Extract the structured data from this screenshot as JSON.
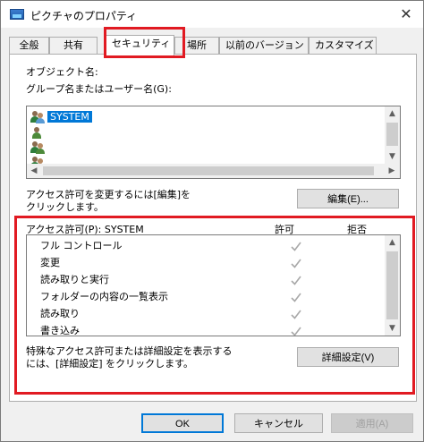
{
  "window": {
    "title": "ピクチャのプロパティ",
    "close_glyph": "✕"
  },
  "tabs": [
    {
      "label": "全般",
      "active": false
    },
    {
      "label": "共有",
      "active": false
    },
    {
      "label": "セキュリティ",
      "active": true
    },
    {
      "label": "場所",
      "active": false
    },
    {
      "label": "以前のバージョン",
      "active": false
    },
    {
      "label": "カスタマイズ",
      "active": false
    }
  ],
  "security": {
    "object_name_label": "オブジェクト名:",
    "group_label": "グループ名またはユーザー名(G):",
    "users": [
      {
        "name": "SYSTEM",
        "selected": true
      },
      {
        "name": "",
        "selected": false
      },
      {
        "name": "",
        "selected": false
      },
      {
        "name": "",
        "selected": false
      }
    ],
    "edit_hint": "アクセス許可を変更するには[編集]を\nクリックします。",
    "edit_button": "編集(E)...",
    "perm_header": "アクセス許可(P): SYSTEM",
    "allow_header": "許可",
    "deny_header": "拒否",
    "permissions": [
      {
        "name": "フル コントロール",
        "allow": true,
        "deny": false
      },
      {
        "name": "変更",
        "allow": true,
        "deny": false
      },
      {
        "name": "読み取りと実行",
        "allow": true,
        "deny": false
      },
      {
        "name": "フォルダーの内容の一覧表示",
        "allow": true,
        "deny": false
      },
      {
        "name": "読み取り",
        "allow": true,
        "deny": false
      },
      {
        "name": "書き込み",
        "allow": true,
        "deny": false
      }
    ],
    "advanced_hint": "特殊なアクセス許可または詳細設定を表示する\nには、[詳細設定] をクリックします。",
    "advanced_button": "詳細設定(V)"
  },
  "footer": {
    "ok": "OK",
    "cancel": "キャンセル",
    "apply": "適用(A)"
  },
  "colors": {
    "highlight": "#e11a22",
    "selection": "#0078d7",
    "check": "#a8a8a8"
  }
}
